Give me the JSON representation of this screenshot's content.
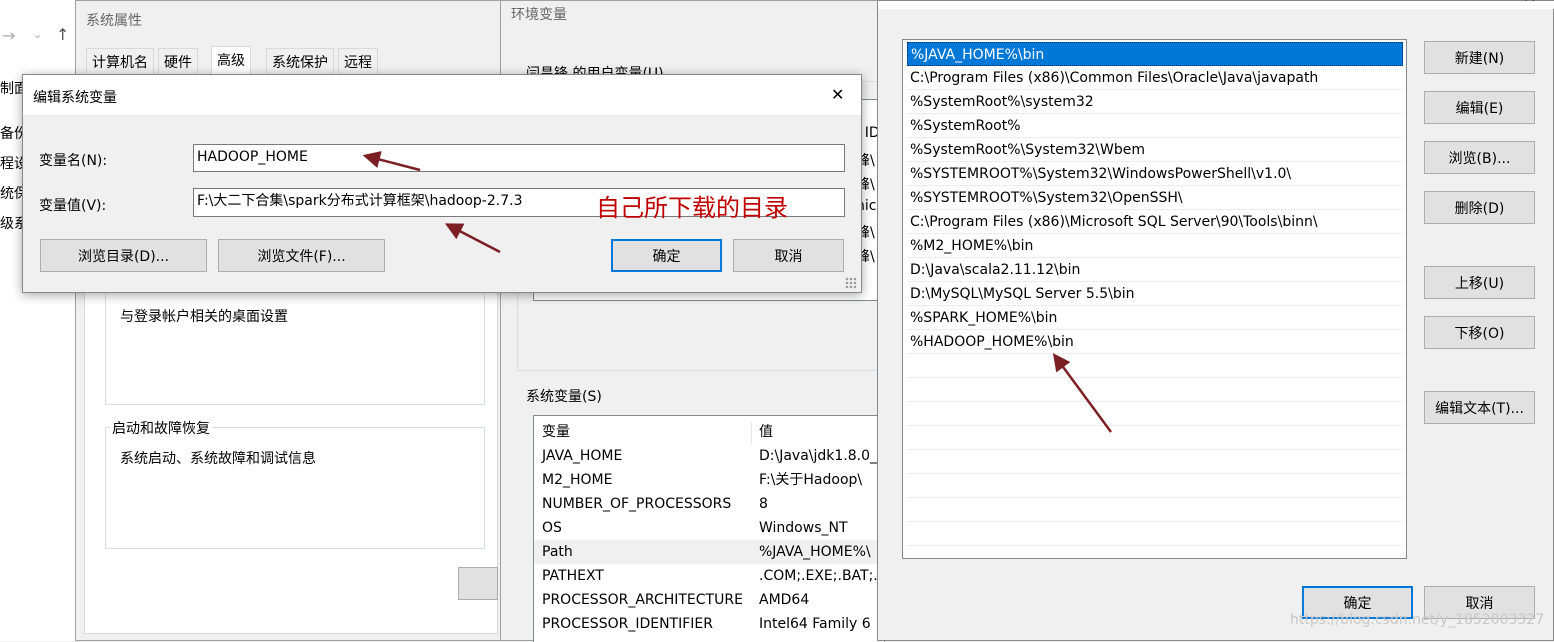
{
  "sysprops": {
    "title": "系统属性",
    "tabs": [
      "计算机名",
      "硬件",
      "高级",
      "系统保护",
      "远程"
    ],
    "userprofile_text": "与登录帐户相关的桌面设置",
    "startup_group": "启动和故障恢复",
    "startup_text": "系统启动、系统故障和调试信息"
  },
  "explorer": {
    "sidebar": [
      "制面",
      "备份",
      "程设",
      "统保",
      "级系"
    ]
  },
  "envvars": {
    "title": "环境变量",
    "user_vars_label": "闫昌锋 的用户变量(U)",
    "system_vars_label": "系统变量(S)",
    "sysvars_columns": [
      "变量",
      "值"
    ],
    "sysvars_rows": [
      {
        "name": "JAVA_HOME",
        "value": "D:\\Java\\jdk1.8.0_"
      },
      {
        "name": "M2_HOME",
        "value": "F:\\关于Hadoop\\"
      },
      {
        "name": "NUMBER_OF_PROCESSORS",
        "value": "8"
      },
      {
        "name": "OS",
        "value": "Windows_NT"
      },
      {
        "name": "Path",
        "value": "%JAVA_HOME%\\"
      },
      {
        "name": "PATHEXT",
        "value": ".COM;.EXE;.BAT;."
      },
      {
        "name": "PROCESSOR_ARCHITECTURE",
        "value": "AMD64"
      },
      {
        "name": "PROCESSOR_IDENTIFIER",
        "value": "Intel64 Family 6"
      }
    ],
    "user_col_partial": [
      "U ID",
      "峰\\",
      "峰\\",
      "nic",
      "峰\\",
      "峰\\"
    ]
  },
  "editvar": {
    "title": "编辑系统变量",
    "name_label": "变量名(N):",
    "name_value": "HADOOP_HOME",
    "value_label": "变量值(V):",
    "value_value": "F:\\大二下合集\\spark分布式计算框架\\hadoop-2.7.3",
    "annotation": "自己所下载的目录",
    "browse_dir": "浏览目录(D)...",
    "browse_file": "浏览文件(F)...",
    "ok": "确定",
    "cancel": "取消",
    "close": "✕"
  },
  "editpath": {
    "title": "编辑环境变量",
    "entries": [
      "%JAVA_HOME%\\bin",
      "C:\\Program Files (x86)\\Common Files\\Oracle\\Java\\javapath",
      "%SystemRoot%\\system32",
      "%SystemRoot%",
      "%SystemRoot%\\System32\\Wbem",
      "%SYSTEMROOT%\\System32\\WindowsPowerShell\\v1.0\\",
      "%SYSTEMROOT%\\System32\\OpenSSH\\",
      "C:\\Program Files (x86)\\Microsoft SQL Server\\90\\Tools\\binn\\",
      "%M2_HOME%\\bin",
      "D:\\Java\\scala2.11.12\\bin",
      "D:\\MySQL\\MySQL Server 5.5\\bin",
      "%SPARK_HOME%\\bin",
      "%HADOOP_HOME%\\bin"
    ],
    "buttons": {
      "new": "新建(N)",
      "edit": "编辑(E)",
      "browse": "浏览(B)...",
      "delete": "删除(D)",
      "moveup": "上移(U)",
      "movedown": "下移(O)",
      "edittext": "编辑文本(T)...",
      "ok": "确定",
      "cancel": "取消"
    },
    "close": "✕"
  },
  "watermark": "https://blog.csdn.net/y_1852003327",
  "colors": {
    "selection": "#0078d7",
    "annotation": "#c00000",
    "arrow": "#7b1f24"
  }
}
